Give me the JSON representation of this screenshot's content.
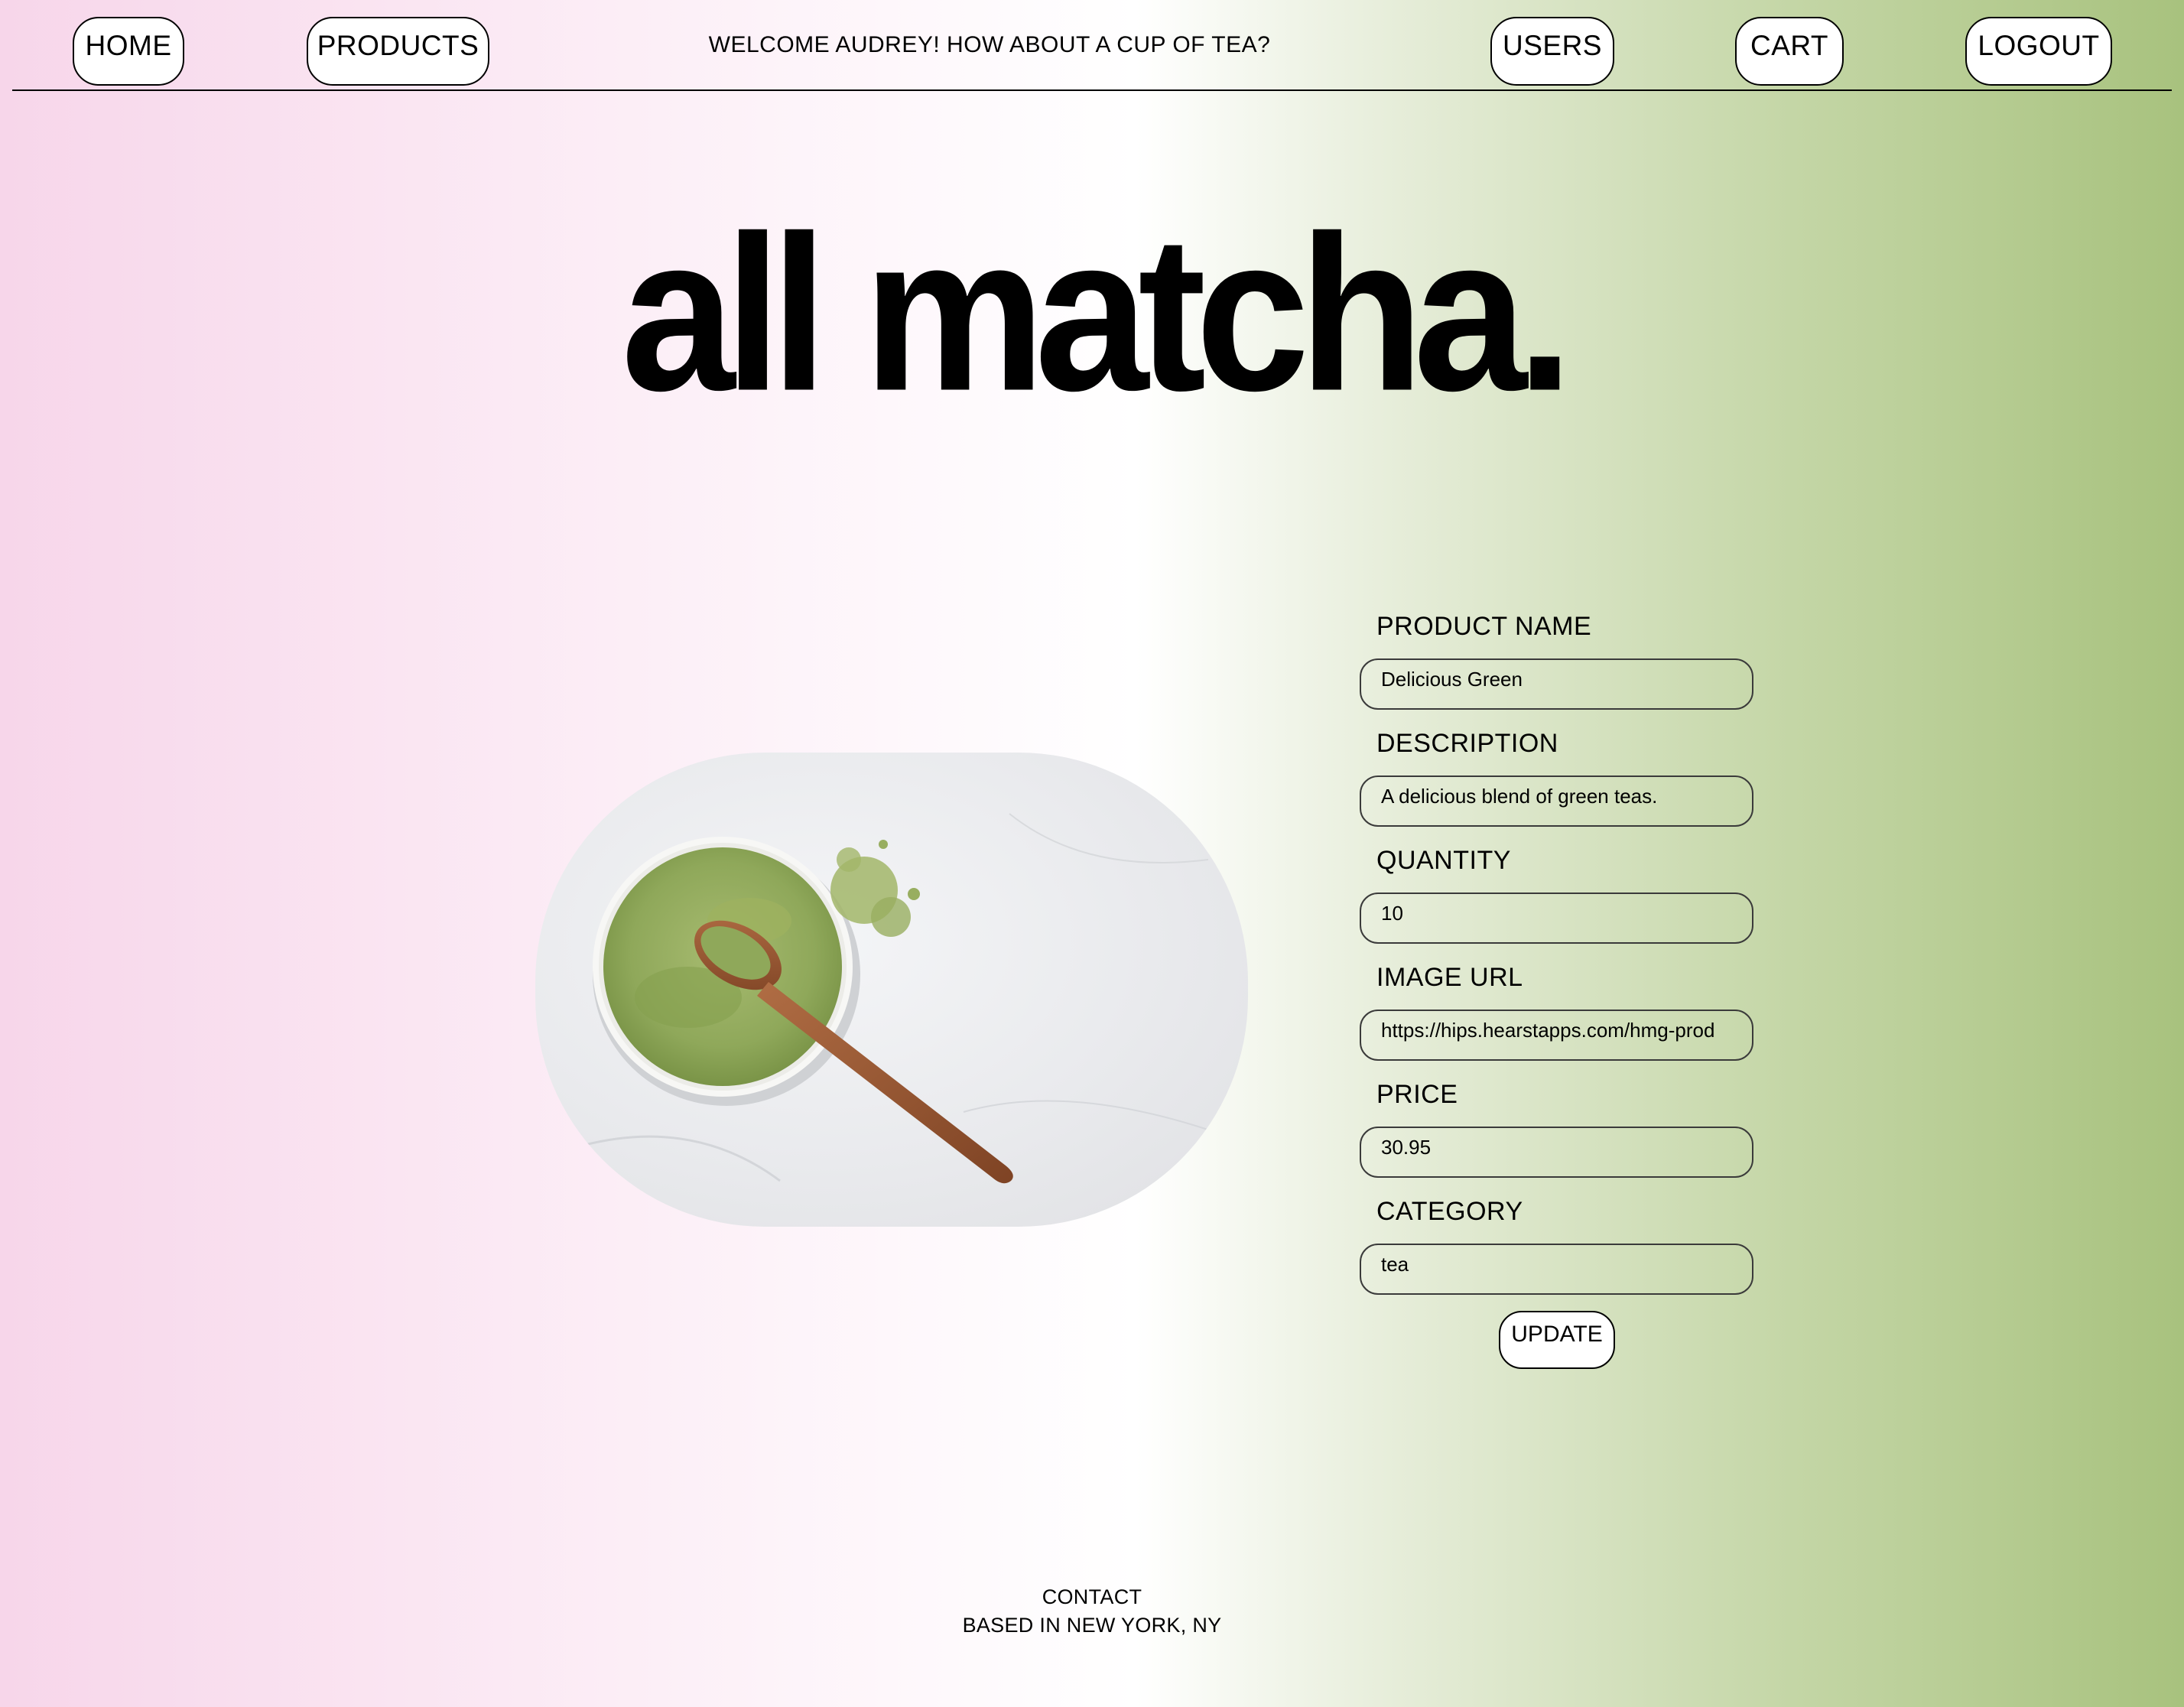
{
  "nav": {
    "home": "HOME",
    "products": "PRODUCTS",
    "welcome": "WELCOME AUDREY! HOW ABOUT A CUP OF TEA?",
    "users": "USERS",
    "cart": "CART",
    "logout": "LOGOUT"
  },
  "hero": {
    "title": "all matcha."
  },
  "form": {
    "product_name_label": "PRODUCT NAME",
    "product_name_value": "Delicious Green",
    "description_label": "DESCRIPTION",
    "description_value": "A delicious blend of green teas.",
    "quantity_label": "QUANTITY",
    "quantity_value": "10",
    "image_url_label": "IMAGE URL",
    "image_url_value": "https://hips.hearstapps.com/hmg-prod",
    "price_label": "PRICE",
    "price_value": "30.95",
    "category_label": "CATEGORY",
    "category_value": "tea",
    "update_label": "UPDATE"
  },
  "footer": {
    "contact": "CONTACT",
    "location": "BASED IN NEW YORK, NY"
  },
  "colors": {
    "gradient_left": "#f7d6ea",
    "gradient_mid": "#ffffff",
    "gradient_right": "#a8c27e",
    "matcha": "#8fa85a",
    "spoon": "#9a5a35"
  }
}
